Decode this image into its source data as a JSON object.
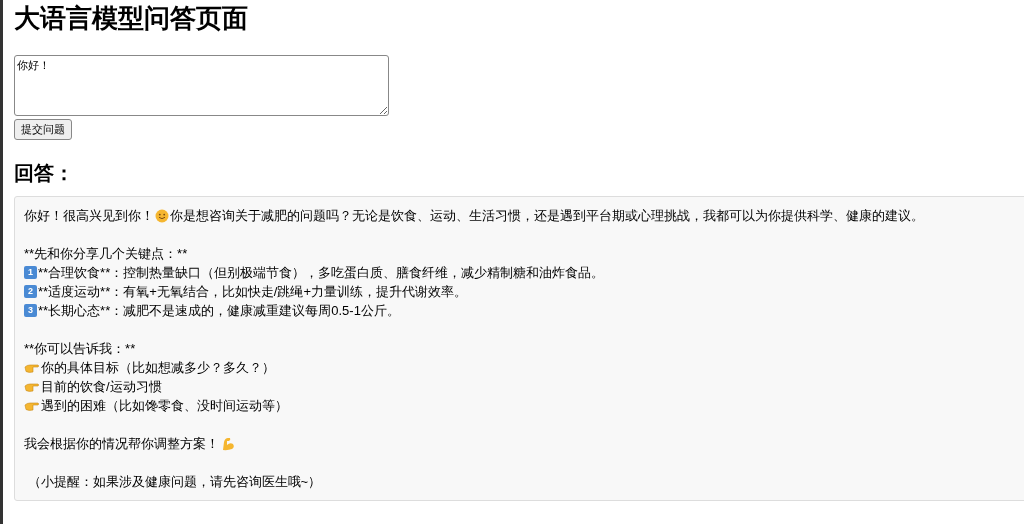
{
  "title": "大语言模型问答页面",
  "question": {
    "value": "你好！"
  },
  "submit_button": "提交问题",
  "answer_heading": "回答：",
  "answer": {
    "lines": [
      {
        "kind": "greeting",
        "before": "你好！很高兴见到你！",
        "after": "你是想咨询关于减肥的问题吗？无论是饮食、运动、生活习惯，还是遇到平台期或心理挑战，我都可以为你提供科学、健康的建议。"
      },
      {
        "kind": "blank"
      },
      {
        "kind": "text",
        "text": "**先和你分享几个关键点：**"
      },
      {
        "kind": "keycap",
        "key": "1",
        "text": "**合理饮食**：控制热量缺口（但别极端节食），多吃蛋白质、膳食纤维，减少精制糖和油炸食品。"
      },
      {
        "kind": "keycap",
        "key": "2",
        "text": "**适度运动**：有氧+无氧结合，比如快走/跳绳+力量训练，提升代谢效率。"
      },
      {
        "kind": "keycap",
        "key": "3",
        "text": "**长期心态**：减肥不是速成的，健康减重建议每周0.5-1公斤。"
      },
      {
        "kind": "blank"
      },
      {
        "kind": "text",
        "text": "**你可以告诉我：**"
      },
      {
        "kind": "pointer",
        "text": "你的具体目标（比如想减多少？多久？）"
      },
      {
        "kind": "pointer",
        "text": "目前的饮食/运动习惯"
      },
      {
        "kind": "pointer",
        "text": "遇到的困难（比如馋零食、没时间运动等）"
      },
      {
        "kind": "blank"
      },
      {
        "kind": "muscle",
        "text": "我会根据你的情况帮你调整方案！"
      },
      {
        "kind": "blank"
      },
      {
        "kind": "text",
        "text": " （小提醒：如果涉及健康问题，请先咨询医生哦~）"
      }
    ]
  }
}
